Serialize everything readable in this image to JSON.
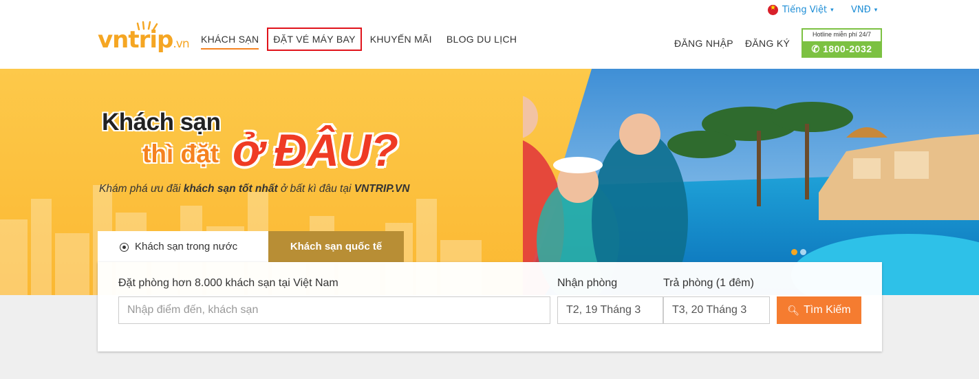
{
  "header": {
    "language_label": "Tiếng Việt",
    "currency_label": "VNĐ",
    "logo": {
      "vn": "vn",
      "trip": "trip",
      "suffix": ".vn"
    },
    "nav": [
      {
        "label": "KHÁCH SẠN"
      },
      {
        "label": "ĐẶT VÉ MÁY BAY"
      },
      {
        "label": "KHUYẾN MÃI"
      },
      {
        "label": "BLOG DU LỊCH"
      }
    ],
    "login_label": "ĐĂNG NHẬP",
    "register_label": "ĐĂNG KÝ",
    "hotline": {
      "label": "Hotline miễn phí 24/7",
      "number": "1800-2032"
    }
  },
  "hero": {
    "headline_line1": "Khách sạn",
    "headline_line2": "thì đặt",
    "headline_emph": "ở ĐÂU?",
    "tagline_part1": "Khám phá ưu đãi ",
    "tagline_bold": "khách sạn tốt nhất",
    "tagline_part2": " ở bất kì đâu tại ",
    "tagline_brand": "VNTRIP.VN",
    "slide_count": 2,
    "active_slide": 1
  },
  "search": {
    "tabs": [
      {
        "label": "Khách sạn trong nước",
        "selected": true
      },
      {
        "label": "Khách sạn quốc tế",
        "selected": false
      }
    ],
    "subtitle": "Đặt phòng hơn 8.000 khách sạn tại Việt Nam",
    "destination_placeholder": "Nhập điểm đến, khách sạn",
    "checkin_label": "Nhận phòng",
    "checkout_label": "Trả phòng (1 đêm)",
    "checkin_value": "T2, 19 Tháng 3",
    "checkout_value": "T3, 20 Tháng 3",
    "search_button": "Tìm Kiếm"
  },
  "colors": {
    "accent": "#f58220",
    "hotline_green": "#7cc142",
    "highlight_box": "#e0121a",
    "intl_tab": "#b88e35"
  }
}
